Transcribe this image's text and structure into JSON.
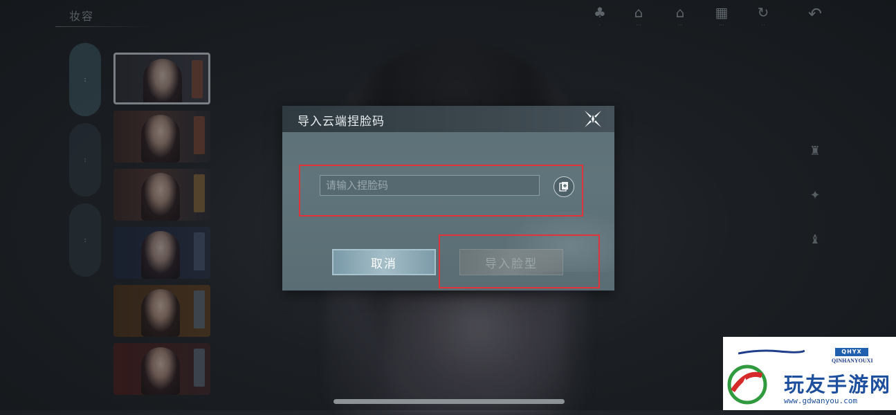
{
  "background": {
    "top_title": "妆容"
  },
  "toolbar": {
    "items": [
      {
        "icon": "tree-icon",
        "caption": "·"
      },
      {
        "icon": "home-icon",
        "caption": "···"
      },
      {
        "icon": "home-alt-icon",
        "caption": "···"
      },
      {
        "icon": "grid-icon",
        "caption": "···"
      },
      {
        "icon": "refresh-icon",
        "caption": "··"
      }
    ],
    "back_icon": "undo-icon"
  },
  "side_tabs": [
    {
      "label": "··"
    },
    {
      "label": "··"
    },
    {
      "label": "··"
    }
  ],
  "dialog": {
    "title": "导入云端捏脸码",
    "close_icon": "close-x-icon",
    "input_placeholder": "请输入捏脸码",
    "input_value": "",
    "paste_icon": "paste-icon",
    "cancel_label": "取消",
    "import_label": "导入脸型"
  },
  "watermark": {
    "badge": "QHYX",
    "subtitle": "QINHANYOUXI",
    "title": "玩友手游网",
    "url": "www.gdwanyou.com"
  },
  "colors": {
    "highlight": "#e0333a",
    "dialog_header": "#2f3a40",
    "cancel_button": "#a4bec8",
    "watermark_blue": "#1e4f9e"
  }
}
